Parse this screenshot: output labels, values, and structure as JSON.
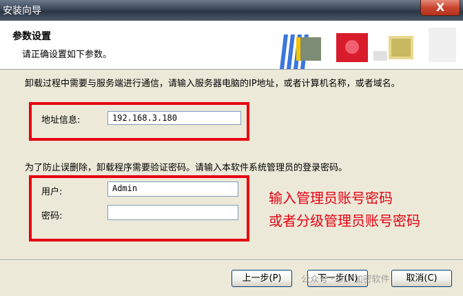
{
  "window": {
    "title": "安装向导",
    "close_label": "X"
  },
  "header": {
    "title": "参数设置",
    "subtitle": "请正确设置如下参数。"
  },
  "server": {
    "description": "卸载过程中需要与服务端进行通信，请输入服务器电脑的IP地址，或者计算机名称，或者域名。",
    "address_label": "地址信息:",
    "address_value": "192.168.3.180"
  },
  "auth": {
    "description": "为了防止误删除，卸载程序需要验证密码。请输入本软件系统管理员的登录密码。",
    "user_label": "用户:",
    "user_value": "Admin",
    "password_label": "密码:",
    "password_value": ""
  },
  "annotation": {
    "line1": "输入管理员账号密码",
    "line2": "或者分级管理员账号密码"
  },
  "buttons": {
    "back": "上一步(P)",
    "next": "下一步(N)",
    "cancel": "取消(C)"
  },
  "watermark": "公众号 · DLP加密软件",
  "colors": {
    "highlight": "#e60012",
    "banner_blue": "#1a5fd6",
    "banner_yellow": "#f5c400",
    "banner_red": "#d81c2c"
  }
}
